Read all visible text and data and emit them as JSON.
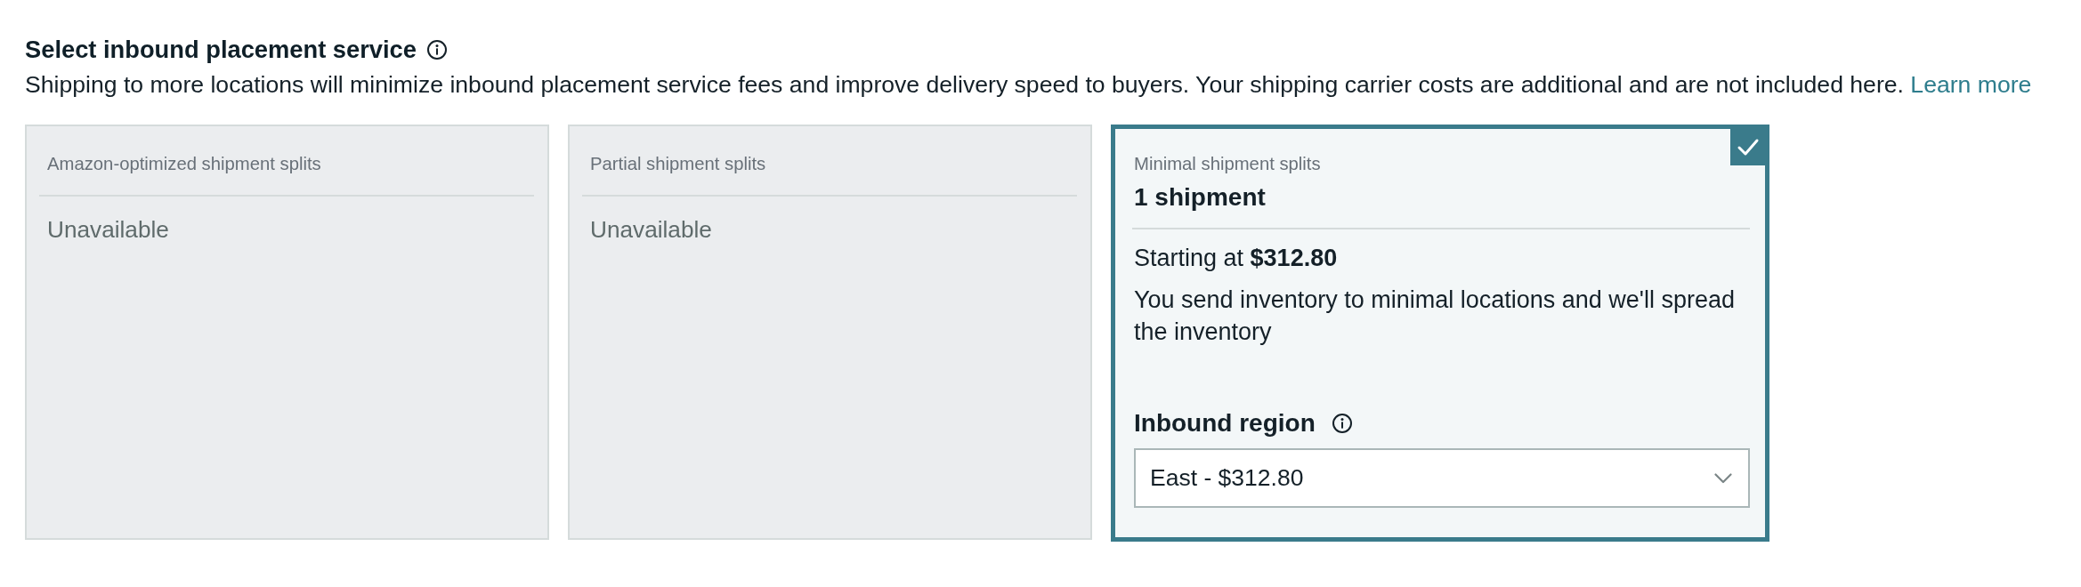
{
  "section": {
    "title": "Select inbound placement service",
    "description": "Shipping to more locations will minimize inbound placement service fees and improve delivery speed to buyers. Your shipping carrier costs are additional and are not included here.",
    "link": "Learn more"
  },
  "options": [
    {
      "kind": "unavailable",
      "label": "Amazon-optimized shipment splits",
      "status": "Unavailable",
      "selected": false
    },
    {
      "kind": "unavailable",
      "label": "Partial shipment splits",
      "status": "Unavailable",
      "selected": false
    },
    {
      "kind": "available",
      "label": "Minimal shipment splits",
      "title": "1 shipment",
      "price": "Starting at **$312.80**",
      "description": "You send inventory to minimal locations and we'll spread the inventory",
      "field_label": "Inbound region",
      "field_value": "East - $312.80",
      "selected": true
    }
  ]
}
